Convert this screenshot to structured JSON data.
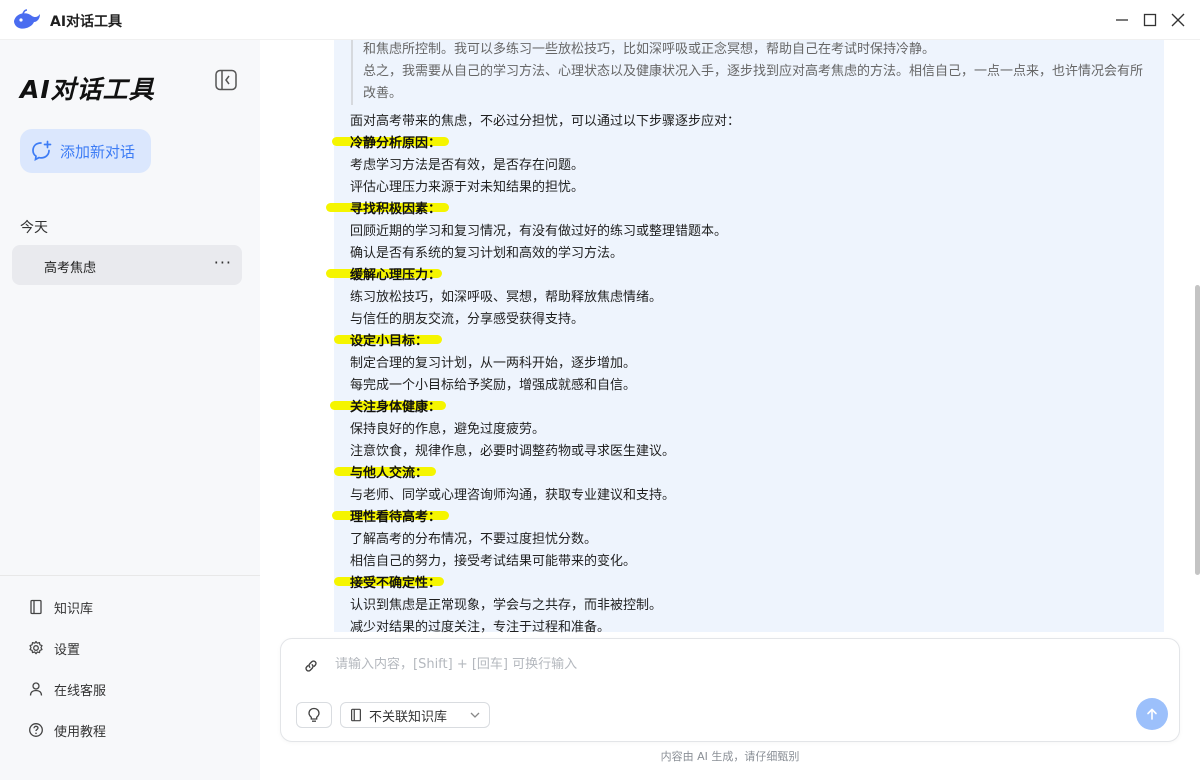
{
  "window": {
    "title": "AI对话工具"
  },
  "sidebar": {
    "brand": "AI对话工具",
    "new_chat_label": "添加新对话",
    "section_today": "今天",
    "conversations": [
      {
        "label": "高考焦虑",
        "more": "···"
      }
    ],
    "links": [
      {
        "label": "知识库",
        "icon": "book-icon"
      },
      {
        "label": "设置",
        "icon": "gear-icon"
      },
      {
        "label": "在线客服",
        "icon": "user-icon"
      },
      {
        "label": "使用教程",
        "icon": "help-icon"
      }
    ]
  },
  "chat": {
    "quote_lines": [
      "和焦虑所控制。我可以多练习一些放松技巧，比如深呼吸或正念冥想，帮助自己在考试时保持冷静。",
      "总之，我需要从自己的学习方法、心理状态以及健康状况入手，逐步找到应对高考焦虑的方法。相信自己，一点一点来，也许情况会有所改善。"
    ],
    "intro": "面对高考带来的焦虑，不必过分担忧，可以通过以下步骤逐步应对：",
    "sections": [
      {
        "heading": "冷静分析原因：",
        "items": [
          "考虑学习方法是否有效，是否存在问题。",
          "评估心理压力来源于对未知结果的担忧。"
        ]
      },
      {
        "heading": "寻找积极因素：",
        "items": [
          "回顾近期的学习和复习情况，有没有做过好的练习或整理错题本。",
          "确认是否有系统的复习计划和高效的学习方法。"
        ]
      },
      {
        "heading": "缓解心理压力：",
        "items": [
          "练习放松技巧，如深呼吸、冥想，帮助释放焦虑情绪。",
          "与信任的朋友交流，分享感受获得支持。"
        ]
      },
      {
        "heading": "设定小目标：",
        "items": [
          "制定合理的复习计划，从一两科开始，逐步增加。",
          "每完成一个小目标给予奖励，增强成就感和自信。"
        ]
      },
      {
        "heading": "关注身体健康：",
        "items": [
          "保持良好的作息，避免过度疲劳。",
          "注意饮食，规律作息，必要时调整药物或寻求医生建议。"
        ]
      },
      {
        "heading": "与他人交流：",
        "items": [
          "与老师、同学或心理咨询师沟通，获取专业建议和支持。"
        ]
      },
      {
        "heading": "理性看待高考：",
        "items": [
          "了解高考的分布情况，不要过度担忧分数。",
          "相信自己的努力，接受考试结果可能带来的变化。"
        ]
      },
      {
        "heading": "接受不确定性：",
        "items": [
          "认识到焦虑是正常现象，学会与之共存，而非被控制。",
          "减少对结果的过度关注，专注于过程和准备。"
        ]
      }
    ]
  },
  "composer": {
    "placeholder": "请输入内容，[Shift] + [回车] 可换行输入",
    "kb_label": "不关联知识库",
    "footer": "内容由 AI 生成，请仔细甄别"
  },
  "colors": {
    "accent": "#3d7cf5",
    "highlight": "#f5f500",
    "bubble_bg": "#eef4fd",
    "send_button": "#9cc0fb"
  }
}
